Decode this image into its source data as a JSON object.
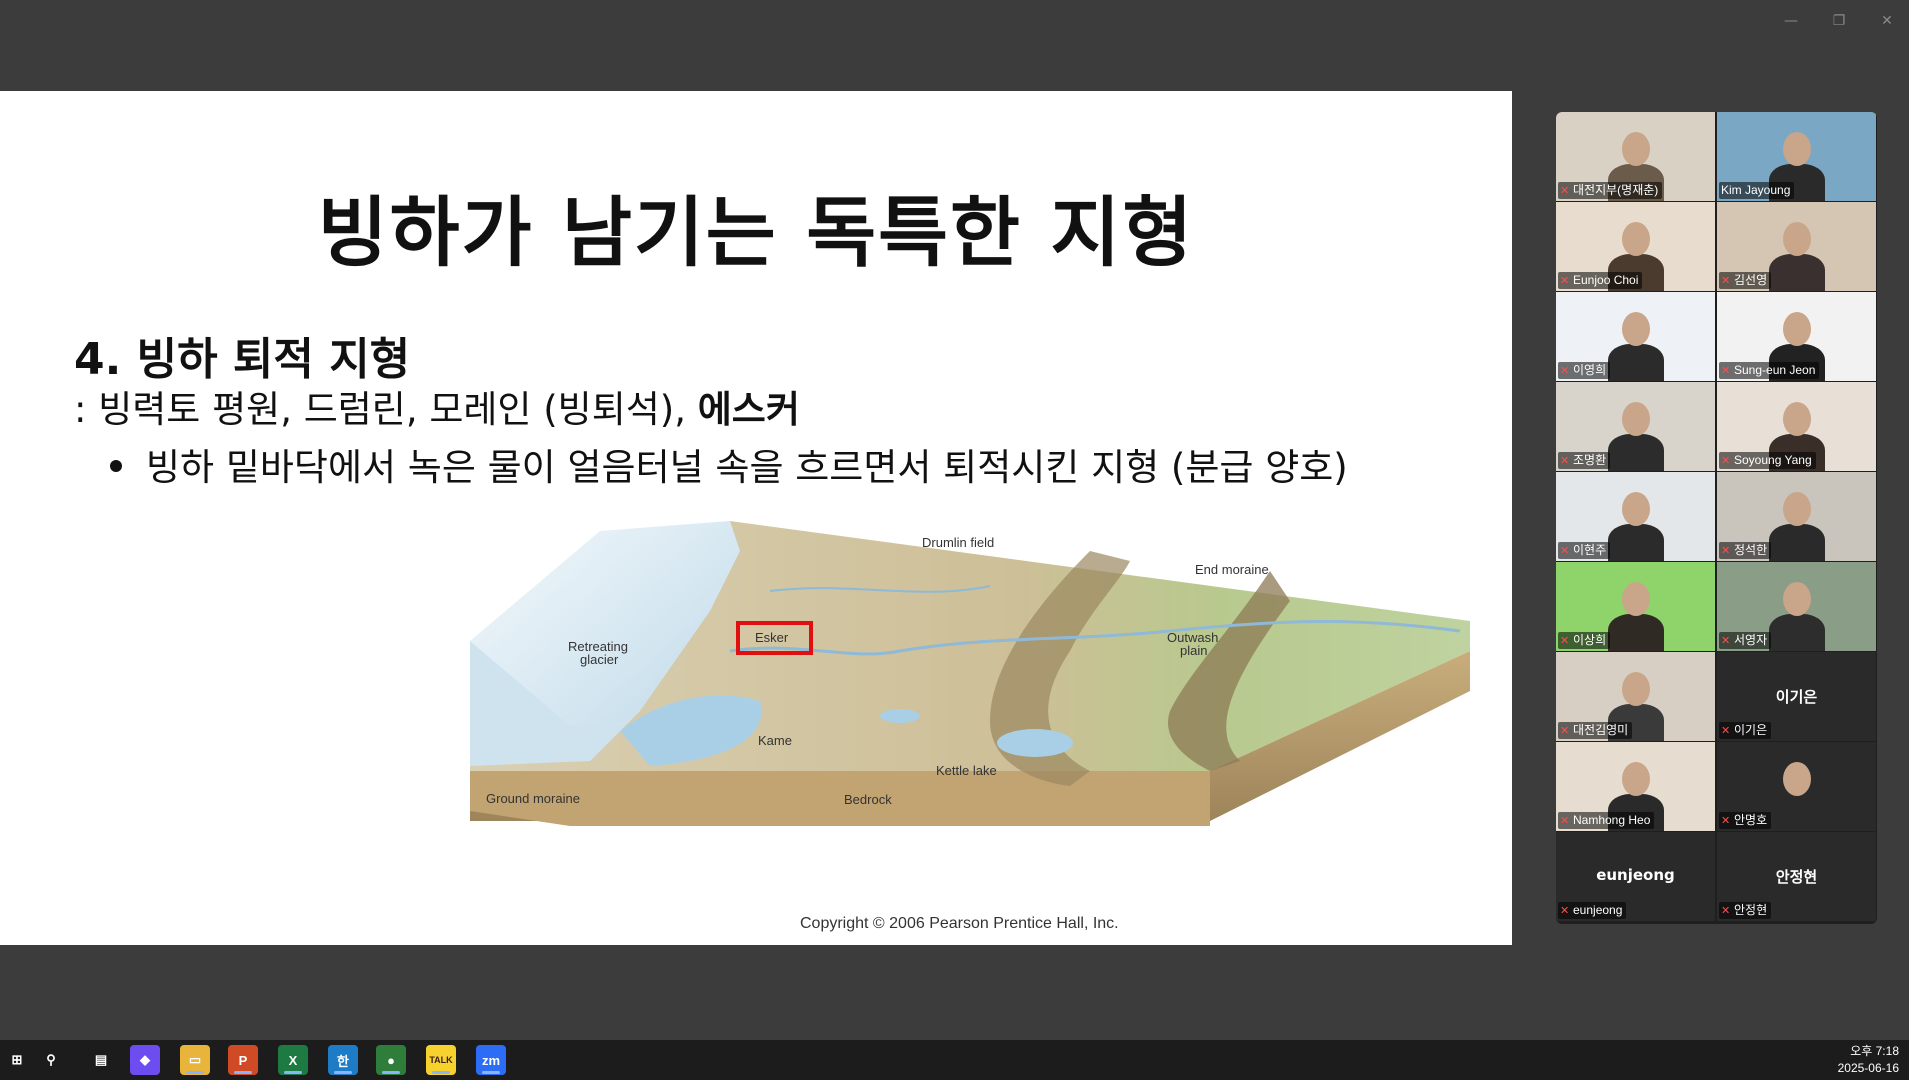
{
  "window": {
    "min_label": "—",
    "restore_label": "❐",
    "close_label": "✕"
  },
  "slide": {
    "title": "빙하가 남기는 독특한 지형",
    "heading": "4. 빙하 퇴적 지형",
    "line_prefix": ": 빙력토 평원, 드럼린, 모레인 (빙퇴석), ",
    "line_bold": "에스커",
    "bullet": "빙하 밑바닥에서 녹은 물이 얼음터널 속을 흐르면서 퇴적시킨 지형 (분급 양호)",
    "diagram_labels": {
      "drumlin": "Drumlin field",
      "end_moraine": "End moraine",
      "retreating": "Retreating",
      "glacier": "glacier",
      "esker": "Esker",
      "outwash1": "Outwash",
      "outwash2": "plain",
      "kame": "Kame",
      "kettle": "Kettle lake",
      "ground_moraine": "Ground moraine",
      "bedrock": "Bedrock"
    },
    "copyright": "Copyright © 2006 Pearson Prentice Hall, Inc."
  },
  "participants": [
    {
      "name": "대전지부(명재춘)",
      "video": true,
      "active": false
    },
    {
      "name": "Kim Jayoung",
      "video": true,
      "active": true
    },
    {
      "name": "Eunjoo Choi",
      "video": true,
      "active": false
    },
    {
      "name": "김선영",
      "video": true,
      "active": false
    },
    {
      "name": "이영희",
      "video": true,
      "active": false
    },
    {
      "name": "Sung-eun Jeon",
      "video": true,
      "active": false
    },
    {
      "name": "조명환",
      "video": true,
      "active": false
    },
    {
      "name": "Soyoung Yang",
      "video": true,
      "active": false
    },
    {
      "name": "이현주",
      "video": true,
      "active": false
    },
    {
      "name": "정석한",
      "video": true,
      "active": false
    },
    {
      "name": "이상희",
      "video": true,
      "active": false
    },
    {
      "name": "서영자",
      "video": true,
      "active": false
    },
    {
      "name": "대전김영미",
      "video": true,
      "active": false
    },
    {
      "name": "이기은",
      "video": false,
      "display": "이기은",
      "active": false
    },
    {
      "name": "Namhong Heo",
      "video": true,
      "active": false
    },
    {
      "name": "안명호",
      "video": true,
      "active": false
    },
    {
      "name": "eunjeong",
      "video": false,
      "display": "eunjeong",
      "active": false
    },
    {
      "name": "안정현",
      "video": false,
      "display": "안정현",
      "active": false
    }
  ],
  "taskbar": {
    "icons": [
      {
        "name": "start-icon",
        "glyph": "⊞",
        "color": "#1c1c1c"
      },
      {
        "name": "search-icon",
        "glyph": "⚲",
        "color": "#1c1c1c"
      },
      {
        "name": "task-view-icon",
        "glyph": "▤",
        "color": "#1c1c1c"
      },
      {
        "name": "copilot-icon",
        "glyph": "◆",
        "color": "#6d4cf0"
      },
      {
        "name": "file-explorer-icon",
        "glyph": "▭",
        "color": "#e8b53a"
      },
      {
        "name": "powerpoint-icon",
        "glyph": "P",
        "color": "#d04a26"
      },
      {
        "name": "excel-icon",
        "glyph": "X",
        "color": "#1d7a43"
      },
      {
        "name": "hancom-icon",
        "glyph": "한",
        "color": "#1e7cc6"
      },
      {
        "name": "chrome-icon",
        "glyph": "●",
        "color": "#2f7d3a"
      },
      {
        "name": "kakaotalk-icon",
        "glyph": "TALK",
        "color": "#f7d22e"
      },
      {
        "name": "zoom-icon",
        "glyph": "zm",
        "color": "#2d6cf5"
      }
    ],
    "time": "오후 7:18",
    "date": "2025-06-16"
  }
}
